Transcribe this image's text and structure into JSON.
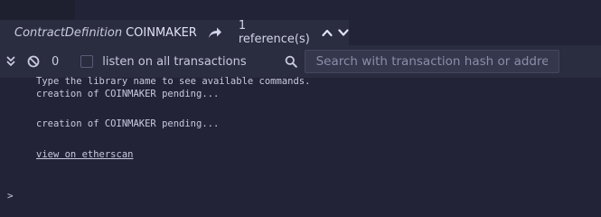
{
  "definition_bar": {
    "type_label": "ContractDefinition",
    "name": "COINMAKER",
    "references": "1 reference(s)"
  },
  "terminal_toolbar": {
    "pending_count": "0",
    "listen_label": "listen on all transactions",
    "search_placeholder": "Search with transaction hash or address"
  },
  "output": {
    "lines": [
      "Type the library name to see available commands.",
      "creation of COINMAKER pending...",
      "creation of COINMAKER pending...",
      "view on etherscan"
    ]
  },
  "prompt": {
    "symbol": ">"
  },
  "icons": {
    "goto": "share-arrow-icon",
    "up": "chevron-up-icon",
    "down": "chevron-down-icon",
    "collapse": "double-chevron-down-icon",
    "clear": "ban-icon",
    "search": "search-icon"
  },
  "colors": {
    "background": "#222336",
    "bar": "#2a2c3f",
    "text": "#c8c9e0"
  }
}
